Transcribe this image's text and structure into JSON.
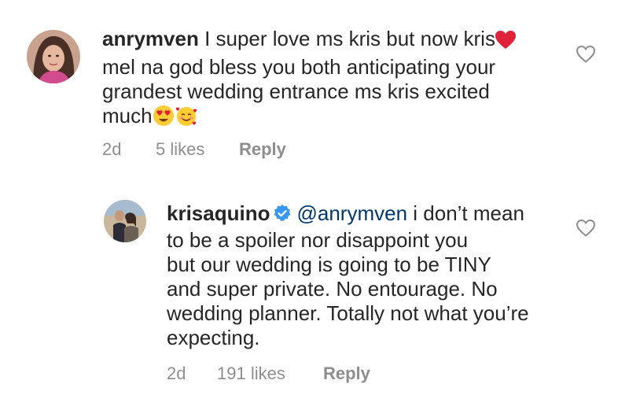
{
  "comments": [
    {
      "username": "anrymven",
      "text_before_heart": " I super love ms kris but now kris",
      "text_after_heart": "mel na god bless you both anticipating your grandest wedding entrance ms kris excited much",
      "line1_text": " I super love ms kris but now kris",
      "line2": "mel na god bless you both anticipating your",
      "line3": "grandest wedding entrance ms kris excited",
      "line4": "much",
      "time": "2d",
      "likes": "5 likes",
      "reply_label": "Reply",
      "avatar_icon": "user-avatar-photo",
      "emojis": [
        "red-heart-emoji",
        "heart-eyes-emoji",
        "smiling-face-with-hearts-emoji"
      ]
    },
    {
      "username": "krisaquino",
      "verified_icon": "verified-badge-icon",
      "mention": "@anrymven",
      "line1_rest": " i don’t mean",
      "line2": "to be a spoiler nor disappoint you",
      "line3": "but our wedding is going to be TINY",
      "line4": "and super private. No entourage. No",
      "line5": "wedding planner. Totally not what you’re",
      "line6": "expecting.",
      "time": "2d",
      "likes": "191 likes",
      "reply_label": "Reply",
      "avatar_icon": "couple-avatar-photo"
    }
  ],
  "colors": {
    "text": "#262626",
    "meta": "#8e8e8e",
    "mention": "#00376b",
    "verified": "#3897f0",
    "heart_emoji": "#e0213a"
  },
  "like_icon": "heart-outline-icon"
}
